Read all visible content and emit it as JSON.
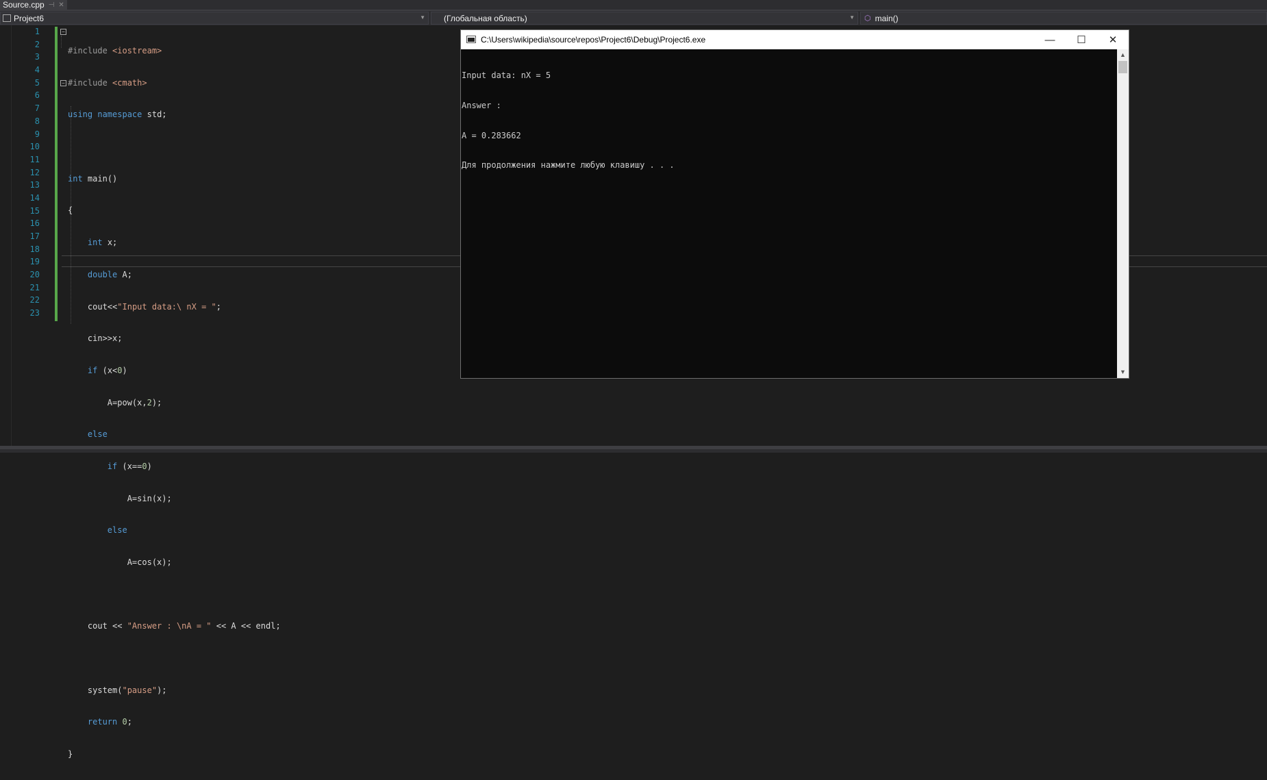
{
  "tab": {
    "title": "Source.cpp",
    "pin_glyph": "⊣",
    "close_glyph": "✕"
  },
  "navbar": {
    "project": "Project6",
    "scope": "(Глобальная область)",
    "member": "main()"
  },
  "editor": {
    "line_numbers": [
      "1",
      "2",
      "3",
      "4",
      "5",
      "6",
      "7",
      "8",
      "9",
      "10",
      "11",
      "12",
      "13",
      "14",
      "15",
      "16",
      "17",
      "18",
      "19",
      "20",
      "21",
      "22",
      "23"
    ]
  },
  "console": {
    "title": "C:\\Users\\wikipedia\\source\\repos\\Project6\\Debug\\Project6.exe",
    "minimize_glyph": "—",
    "maximize_glyph": "☐",
    "close_glyph": "✕",
    "lines": [
      "Input data: nX = 5",
      "Answer :",
      "A = 0.283662",
      "Для продолжения нажмите любую клавишу . . ."
    ]
  },
  "colors": {
    "editor_bg": "#1e1e1e",
    "keyword": "#569cd6",
    "string": "#d69d85",
    "line_number": "#2b91af",
    "change_bar": "#57a64a"
  }
}
